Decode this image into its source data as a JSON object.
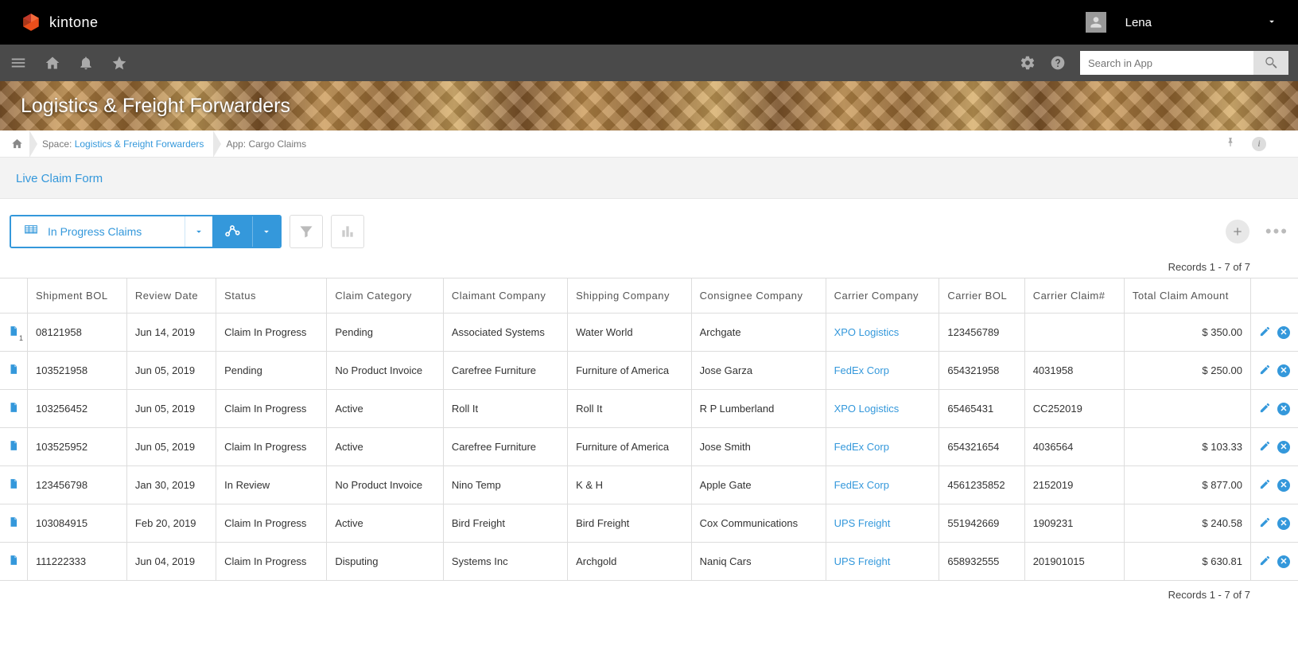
{
  "brand": {
    "name": "kintone"
  },
  "user": {
    "name": "Lena"
  },
  "search": {
    "placeholder": "Search in App"
  },
  "banner": {
    "title": "Logistics & Freight Forwarders"
  },
  "breadcrumb": {
    "space_label": "Space:",
    "space_link": "Logistics & Freight Forwarders",
    "app_label": "App: Cargo Claims"
  },
  "subheader": {
    "link": "Live Claim Form"
  },
  "view": {
    "name": "In Progress Claims"
  },
  "records": {
    "top": "Records 1 - 7 of 7",
    "bottom": "Records 1 - 7 of 7"
  },
  "columns": [
    "Shipment BOL",
    "Review Date",
    "Status",
    "Claim Category",
    "Claimant Company",
    "Shipping Company",
    "Consignee Company",
    "Carrier Company",
    "Carrier BOL",
    "Carrier Claim#",
    "Total Claim Amount"
  ],
  "rows": [
    {
      "bol": "08121958",
      "date": "Jun 14, 2019",
      "status": "Claim In Progress",
      "category": "Pending",
      "claimant": "Associated Systems",
      "shipping": "Water World",
      "consignee": "Archgate",
      "carrier": "XPO Logistics",
      "carrier_bol": "123456789",
      "carrier_claim": "",
      "amount": "$ 350.00"
    },
    {
      "bol": "103521958",
      "date": "Jun 05, 2019",
      "status": "Pending",
      "category": "No Product Invoice",
      "claimant": "Carefree Furniture",
      "shipping": "Furniture of America",
      "consignee": "Jose Garza",
      "carrier": "FedEx Corp",
      "carrier_bol": "654321958",
      "carrier_claim": "4031958",
      "amount": "$ 250.00"
    },
    {
      "bol": "103256452",
      "date": "Jun 05, 2019",
      "status": "Claim In Progress",
      "category": "Active",
      "claimant": "Roll It",
      "shipping": "Roll It",
      "consignee": "R P Lumberland",
      "carrier": "XPO Logistics",
      "carrier_bol": "65465431",
      "carrier_claim": "CC252019",
      "amount": ""
    },
    {
      "bol": "103525952",
      "date": "Jun 05, 2019",
      "status": "Claim In Progress",
      "category": "Active",
      "claimant": "Carefree Furniture",
      "shipping": "Furniture of America",
      "consignee": "Jose Smith",
      "carrier": "FedEx Corp",
      "carrier_bol": "654321654",
      "carrier_claim": "4036564",
      "amount": "$ 103.33"
    },
    {
      "bol": "123456798",
      "date": "Jan 30, 2019",
      "status": "In Review",
      "category": "No Product Invoice",
      "claimant": "Nino Temp",
      "shipping": "K & H",
      "consignee": "Apple Gate",
      "carrier": "FedEx Corp",
      "carrier_bol": "4561235852",
      "carrier_claim": "2152019",
      "amount": "$ 877.00"
    },
    {
      "bol": "103084915",
      "date": "Feb 20, 2019",
      "status": "Claim In Progress",
      "category": "Active",
      "claimant": "Bird Freight",
      "shipping": "Bird Freight",
      "consignee": "Cox Communications",
      "carrier": "UPS Freight",
      "carrier_bol": "551942669",
      "carrier_claim": "1909231",
      "amount": "$ 240.58"
    },
    {
      "bol": "111222333",
      "date": "Jun 04, 2019",
      "status": "Claim In Progress",
      "category": "Disputing",
      "claimant": "Systems Inc",
      "shipping": "Archgold",
      "consignee": "Naniq Cars",
      "carrier": "UPS Freight",
      "carrier_bol": "658932555",
      "carrier_claim": "201901015",
      "amount": "$ 630.81"
    }
  ]
}
